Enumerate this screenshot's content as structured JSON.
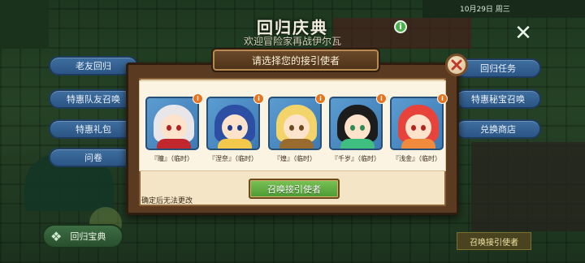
{
  "event": {
    "title": "回归庆典",
    "subtitle": "欢迎冒险家再战伊尔瓦",
    "date_text": "10月29日 周三",
    "info_icon": "info-icon",
    "close_icon": "close-x-icon"
  },
  "left_menu": [
    "老友回归",
    "特惠队友召唤",
    "特惠礼包",
    "问卷"
  ],
  "right_menu": [
    "回归任务",
    "特惠秘宝召唤",
    "兑换商店"
  ],
  "bottom_left": {
    "label": "回归宝典",
    "icon": "flower-icon"
  },
  "bottom_right": {
    "label": "召唤接引使者"
  },
  "modal": {
    "title": "请选择您的接引使者",
    "close_icon": "close-x-icon",
    "characters": [
      {
        "name": "『瞳』（临时）",
        "hair_color": "#e9e6ea",
        "accent": "#c1272d",
        "eye_color": "#b22222"
      },
      {
        "name": "『涅奈』（临时）",
        "hair_color": "#2c4fa3",
        "accent": "#f2c94c",
        "eye_color": "#1d3c8a"
      },
      {
        "name": "『煌』（临时）",
        "hair_color": "#f2d46a",
        "accent": "#9a6b2f",
        "eye_color": "#6d4a1f"
      },
      {
        "name": "『千岁』（临时）",
        "hair_color": "#1c1c1c",
        "accent": "#3fbf7f",
        "eye_color": "#2e8b57"
      },
      {
        "name": "『浅金』（临时）",
        "hair_color": "#e8433a",
        "accent": "#f08a3c",
        "eye_color": "#b3261e"
      }
    ],
    "summon_button": "召唤接引使者",
    "note": "确定后无法更改"
  },
  "colors": {
    "modal_frame": "#5b3a22",
    "modal_panel": "#f3e5c5",
    "pill_blue": "#3e6fa0",
    "summon_green": "#5fae42",
    "info_orange": "#e8731b"
  }
}
